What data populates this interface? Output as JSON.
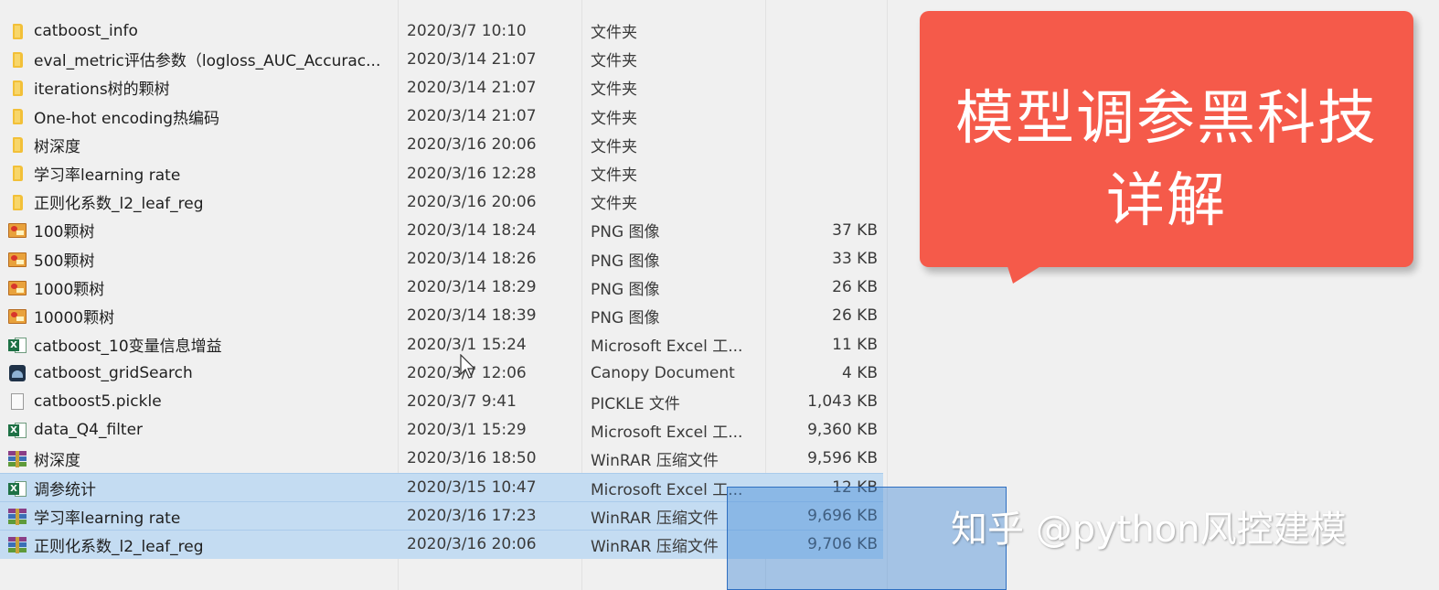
{
  "files": [
    {
      "name": "catboost_info",
      "date": "2020/3/7 10:10",
      "type": "文件夹",
      "size": "",
      "icon": "folder-icon"
    },
    {
      "name": "eval_metric评估参数（logloss_AUC_Accurac...",
      "date": "2020/3/14 21:07",
      "type": "文件夹",
      "size": "",
      "icon": "folder-icon"
    },
    {
      "name": "iterations树的颗树",
      "date": "2020/3/14 21:07",
      "type": "文件夹",
      "size": "",
      "icon": "folder-icon"
    },
    {
      "name": "One-hot encoding热编码",
      "date": "2020/3/14 21:07",
      "type": "文件夹",
      "size": "",
      "icon": "folder-icon"
    },
    {
      "name": "树深度",
      "date": "2020/3/16 20:06",
      "type": "文件夹",
      "size": "",
      "icon": "folder-icon"
    },
    {
      "name": "学习率learning rate",
      "date": "2020/3/16 12:28",
      "type": "文件夹",
      "size": "",
      "icon": "folder-icon"
    },
    {
      "name": "正则化系数_l2_leaf_reg",
      "date": "2020/3/16 20:06",
      "type": "文件夹",
      "size": "",
      "icon": "folder-icon"
    },
    {
      "name": "100颗树",
      "date": "2020/3/14 18:24",
      "type": "PNG 图像",
      "size": "37 KB",
      "icon": "png-image-icon"
    },
    {
      "name": "500颗树",
      "date": "2020/3/14 18:26",
      "type": "PNG 图像",
      "size": "33 KB",
      "icon": "png-image-icon"
    },
    {
      "name": "1000颗树",
      "date": "2020/3/14 18:29",
      "type": "PNG 图像",
      "size": "26 KB",
      "icon": "png-image-icon"
    },
    {
      "name": "10000颗树",
      "date": "2020/3/14 18:39",
      "type": "PNG 图像",
      "size": "26 KB",
      "icon": "png-image-icon"
    },
    {
      "name": "catboost_10变量信息增益",
      "date": "2020/3/1 15:24",
      "type": "Microsoft Excel 工...",
      "size": "11 KB",
      "icon": "excel-icon"
    },
    {
      "name": "catboost_gridSearch",
      "date": "2020/3/7 12:06",
      "type": "Canopy Document",
      "size": "4 KB",
      "icon": "canopy-icon"
    },
    {
      "name": "catboost5.pickle",
      "date": "2020/3/7 9:41",
      "type": "PICKLE 文件",
      "size": "1,043 KB",
      "icon": "blank-file-icon"
    },
    {
      "name": "data_Q4_filter",
      "date": "2020/3/1 15:29",
      "type": "Microsoft Excel 工...",
      "size": "9,360 KB",
      "icon": "excel-icon"
    },
    {
      "name": "树深度",
      "date": "2020/3/16 18:50",
      "type": "WinRAR 压缩文件",
      "size": "9,596 KB",
      "icon": "winrar-icon"
    },
    {
      "name": "调参统计",
      "date": "2020/3/15 10:47",
      "type": "Microsoft Excel 工...",
      "size": "12 KB",
      "icon": "excel-icon",
      "selected": true
    },
    {
      "name": "学习率learning rate",
      "date": "2020/3/16 17:23",
      "type": "WinRAR 压缩文件",
      "size": "9,696 KB",
      "icon": "winrar-icon",
      "selected": true
    },
    {
      "name": "正则化系数_l2_leaf_reg",
      "date": "2020/3/16 20:06",
      "type": "WinRAR 压缩文件",
      "size": "9,706 KB",
      "icon": "winrar-icon",
      "selected": true
    }
  ],
  "callout": {
    "line1": "模型调参黑科技",
    "line2": "详解"
  },
  "watermark": "知乎 @python风控建模",
  "colors": {
    "callout": "#f55a4a",
    "selection": "#c4dcf2",
    "folder": "#f2c038"
  }
}
